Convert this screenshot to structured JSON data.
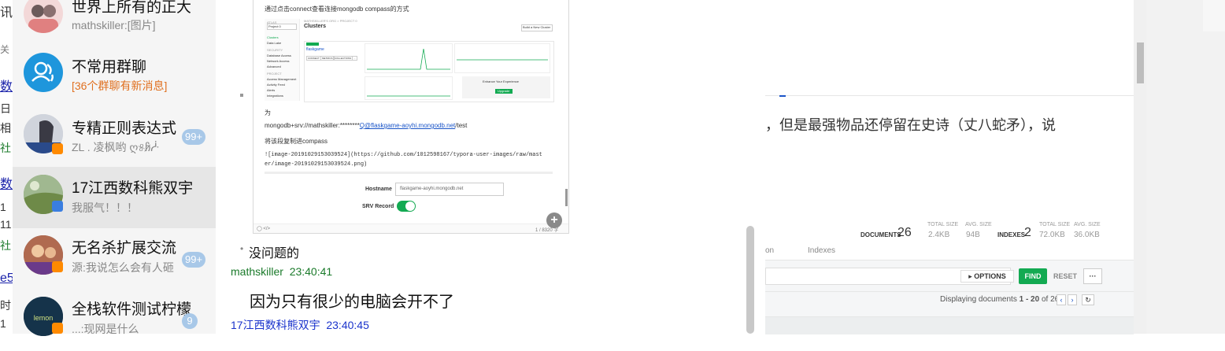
{
  "left_strip": {
    "chars": [
      "讯",
      "关",
      "数",
      "日",
      "相",
      "社",
      "数",
      "1",
      "11",
      "社",
      "e5",
      "时",
      "1"
    ]
  },
  "chat_list": {
    "items": [
      {
        "name": "世界上所有的正大",
        "message": "mathskiller:[图片]",
        "badge": "",
        "selected": false,
        "message_color": "#888888"
      },
      {
        "name": "不常用群聊",
        "message": "[36个群聊有新消息]",
        "badge": "",
        "selected": false,
        "message_color": "#e07020"
      },
      {
        "name": "专精正则表达式",
        "message": "ZL . 凌枫哟  ღ୫ჩ̷ᓿ",
        "badge": "99+",
        "selected": false,
        "message_color": "#888888"
      },
      {
        "name": "17江西数科熊双宇",
        "message": "我服气！！！",
        "badge": "",
        "selected": true,
        "message_color": "#888888"
      },
      {
        "name": "无名杀扩展交流",
        "message": "源:我说怎么会有人砸",
        "badge": "99+",
        "selected": false,
        "message_color": "#888888"
      },
      {
        "name": "全栈软件测试柠檬",
        "message": "...:现网是什么",
        "badge": "9",
        "selected": false,
        "message_color": "#888888"
      }
    ]
  },
  "chat_window": {
    "screenshot": {
      "intro": "通过点击connect查看连接mongodb compass的方式",
      "project_label": "Project 0",
      "org_crumb": "MATHSKILLER'S ORG > PROJECT 0",
      "clusters_title": "Clusters",
      "build_btn": "Build a New Cluster",
      "cluster_name": "flaskgame",
      "sidebar": [
        "ATLAS",
        "Clusters",
        "Data Lake",
        "SECURITY",
        "Database Access",
        "Network Access",
        "Advanced",
        "PROJECT",
        "Access Management",
        "Activity Feed",
        "Alerts",
        "Integrations"
      ],
      "actions": [
        "CONNECT",
        "METRICS",
        "COLLECTIONS",
        "..."
      ],
      "enhance_title": "Enhance Your Experience",
      "upgrade_btn": "Upgrade",
      "wei": "为",
      "uri_prefix": "mongodb+srv://mathskiller:********",
      "uri_link": "Q@flaskgame-aoyhi.mongodb.net",
      "uri_suffix": "/test",
      "paste_text": "将该段复制进compass",
      "img_code_1": "![image-20191029153039524](https://github.com/1012598167/typora-user-images/raw/mast",
      "img_code_2": "er/image-20191029153039524.png)",
      "hostname_label": "Hostname",
      "hostname_value": "flaskgame-aoyhi.mongodb.net",
      "srv_label": "SRV Record",
      "page_count": "1 / 8320 字",
      "footer_left": "◯  </>"
    },
    "messages": [
      {
        "bullet": "•",
        "text": "没问题的"
      },
      {
        "sender": "mathskiller",
        "time": "23:40:41"
      },
      {
        "text": "因为只有很少的电脑会开不了"
      },
      {
        "sender": "17江西数科熊双宇",
        "time": "23:40:45"
      }
    ]
  },
  "browser": {
    "article_text": "，但是最强物品还停留在史诗（丈八蛇矛），说",
    "stats": {
      "documents_label": "DOCUMENTS",
      "documents_value": "26",
      "total_size_label": "TOTAL SIZE",
      "total_size_value": "2.4KB",
      "avg_size_label": "AVG. SIZE",
      "avg_size_value": "94B",
      "indexes_label": "INDEXES",
      "indexes_value": "2",
      "idx_total_label": "TOTAL SIZE",
      "idx_total_value": "72.0KB",
      "idx_avg_label": "AVG. SIZE",
      "idx_avg_value": "36.0KB"
    },
    "tabs": [
      "on",
      "Indexes"
    ],
    "options_btn": "▸ OPTIONS",
    "find_btn": "FIND",
    "reset_btn": "RESET",
    "more_btn": "···",
    "display_prefix": "Displaying documents",
    "display_range": "1 - 20",
    "display_of": "of 26",
    "colors": {
      "find_green": "#13aa52",
      "link_blue": "#1a55c8",
      "sender_green": "#1a7a2a",
      "sender_blue": "#1a33cc"
    }
  }
}
